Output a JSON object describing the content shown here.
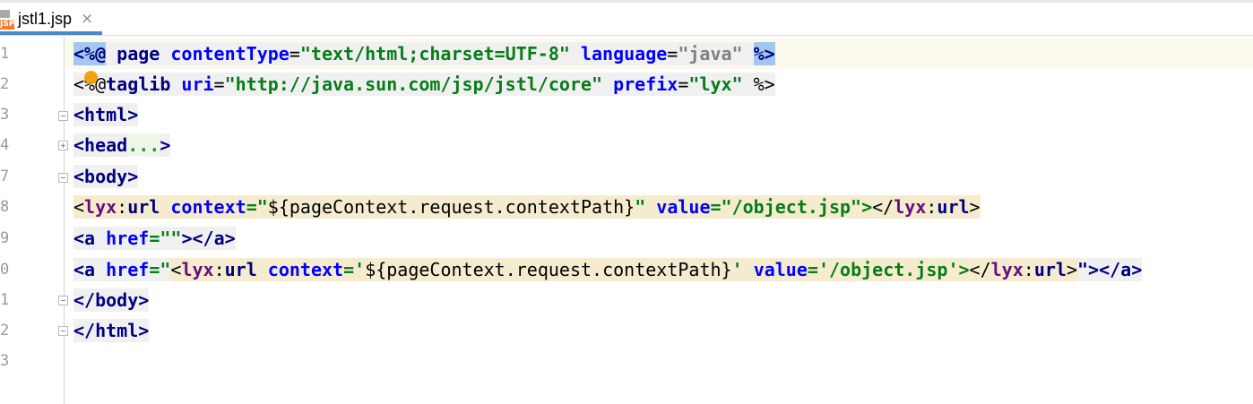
{
  "tab": {
    "icon_text": "JSP",
    "icon": "jsp-file-icon",
    "label": "jstl1.jsp",
    "close": "×",
    "close_icon": "close-icon"
  },
  "gutter": {
    "line_numbers": [
      "1",
      "2",
      "3",
      "4",
      "7",
      "8",
      "9",
      "0",
      "1",
      "2",
      "3"
    ]
  },
  "code": {
    "l1": {
      "open": "<%@",
      "page": "page",
      "ct_attr": "contentType",
      "eq1": "=",
      "ct_val": "\"text/html;charset=UTF-8\"",
      "lang_attr": "language",
      "eq2": "=",
      "lang_val": "\"java\"",
      "close": "%>"
    },
    "l2": {
      "open": "<%@",
      "taglib": "taglib",
      "uri_attr": "uri",
      "eq1": "=",
      "uri_val": "\"http://java.sun.com/jsp/jstl/core\"",
      "prefix_attr": "prefix",
      "eq2": "=",
      "prefix_val": "\"lyx\"",
      "close": "%>"
    },
    "l3": {
      "text": "<html>"
    },
    "l4": {
      "open": "<head",
      "dots": "...",
      "close": ">"
    },
    "l7": {
      "text": "<body>"
    },
    "l8": {
      "lt": "<",
      "ns": "lyx",
      "colon": ":",
      "el": "url",
      "ctx_attr": "context",
      "eq1": "=\"",
      "ctx_val": "${pageContext.request.contextPath}",
      "q1": "\"",
      "val_attr": "value",
      "eq2": "=\"",
      "val_val": "/object.jsp",
      "q2": "\">",
      "end_lt": "</",
      "end_ns": "lyx",
      "end_colon": ":",
      "end_el": "url",
      "end_gt": ">"
    },
    "l9": {
      "open": "<a",
      "href_attr": "href",
      "eq": "=",
      "href_val": "\"\"",
      "rest": "></a>"
    },
    "l10": {
      "open": "<a",
      "href_attr": "href",
      "eq": "=\"",
      "inner_lt": "<",
      "ns": "lyx",
      "colon": ":",
      "el": "url",
      "ctx_attr": "context",
      "eq1": "='",
      "ctx_val": "${pageContext.request.contextPath}",
      "q1": "'",
      "val_attr": "value",
      "eq2": "='",
      "val_val": "/object.jsp",
      "q2": "'>",
      "end_lt": "</",
      "end_ns": "lyx",
      "end_colon": ":",
      "end_el": "url",
      "end_gt": ">",
      "tail": "\"></a>"
    },
    "l11": {
      "text": "</body>"
    },
    "l12": {
      "text": "</html>"
    }
  },
  "colors": {
    "accent_tab": "#4a88c7",
    "tag": "#000080",
    "attribute": "#0000ff",
    "string": "#067d17",
    "namespace": "#660e7a",
    "bulb": "#f0a30a"
  }
}
